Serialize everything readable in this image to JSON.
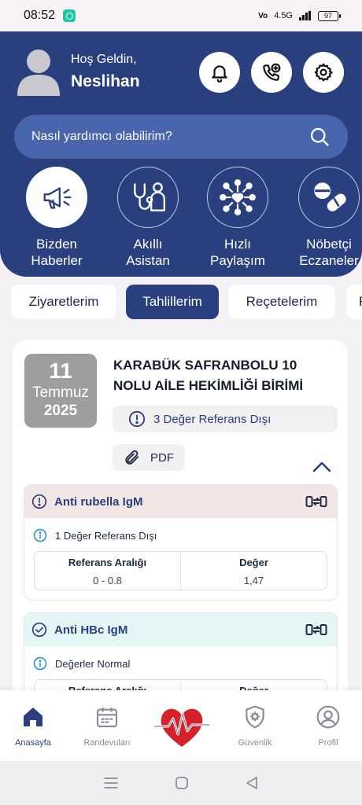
{
  "status_bar": {
    "time": "08:52",
    "network": "4.5G",
    "battery": "97"
  },
  "header": {
    "greeting": "Hoş Geldin,",
    "username": "Neslihan",
    "search_placeholder": "Nasıl yardımcı olabilirim?"
  },
  "quick_actions": [
    {
      "line1": "Bizden",
      "line2": "Haberler",
      "icon": "megaphone-icon",
      "active": true
    },
    {
      "line1": "Akıllı",
      "line2": "Asistan",
      "icon": "stethoscope-doctor-icon"
    },
    {
      "line1": "Hızlı",
      "line2": "Paylaşım",
      "icon": "share-network-heart-icon"
    },
    {
      "line1": "Nöbetçi",
      "line2": "Eczaneler",
      "icon": "pills-icon"
    }
  ],
  "tabs": [
    {
      "label": "Ziyaretlerim"
    },
    {
      "label": "Tahlillerim",
      "active": true
    },
    {
      "label": "Reçetelerim"
    },
    {
      "label": "R"
    }
  ],
  "result_card": {
    "date": {
      "day": "11",
      "month": "Temmuz",
      "year": "2025"
    },
    "clinic": "KARABÜK SAFRANBOLU 10 NOLU AİLE HEKİMLİĞİ BİRİMİ",
    "out_of_range": "3 Değer Referans Dışı",
    "pdf_label": "PDF",
    "tests": [
      {
        "name": "Anti rubella IgM",
        "status": "1 Değer Referans Dışı",
        "state": "warning",
        "ref_header": "Referans Aralığı",
        "value_header": "Değer",
        "ref_range": "0 - 0.8",
        "value": "1,47"
      },
      {
        "name": "Anti HBc IgM",
        "status": "Değerler Normal",
        "state": "normal",
        "ref_header": "Referans Aralığı",
        "value_header": "Değer"
      }
    ]
  },
  "bottom_nav": [
    {
      "label": "Anasayfa",
      "icon": "home-icon",
      "active": true
    },
    {
      "label": "Randevuları",
      "icon": "calendar-icon"
    },
    {
      "label": "",
      "icon": "heart-logo-icon"
    },
    {
      "label": "Güvenlik",
      "icon": "shield-gear-icon"
    },
    {
      "label": "Profil",
      "icon": "user-icon"
    }
  ],
  "colors": {
    "primary": "#2a3f7e",
    "search_bg": "#4965ad",
    "warning_bg": "#f3e7e6",
    "normal_bg": "#e4f7f6",
    "date_box": "#9e9e9e",
    "heart_red": "#d4212a"
  }
}
